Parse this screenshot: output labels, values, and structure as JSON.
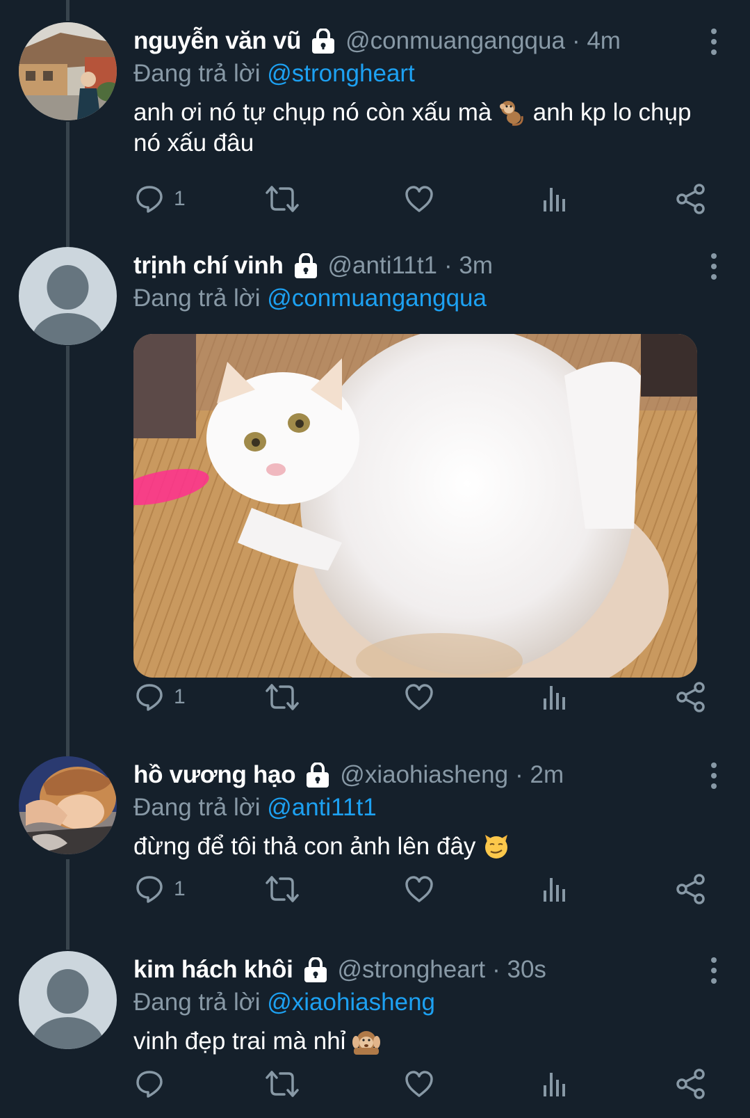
{
  "theme": {
    "background": "#15202b",
    "accent": "#1da1f2",
    "secondary_text": "#8899a6",
    "thread_line": "#38444d"
  },
  "tweets": [
    {
      "name": "nguyễn văn vũ",
      "handle": "@conmuangangqua",
      "time": "· 4m",
      "replying_prefix": "Đang trả lời",
      "replying_to": "@strongheart",
      "text_before_emoji": "anh ơi nó tự chụp nó còn xấu mà",
      "emoji": "monkey",
      "text_after_emoji": "anh kp lo chụp nó xấu đâu",
      "reply_count": "1",
      "avatar": "photo-person-street"
    },
    {
      "name": "trịnh chí vinh",
      "handle": "@anti11t1",
      "time": "· 3m",
      "replying_prefix": "Đang trả lời",
      "replying_to": "@conmuangangqua",
      "media": "white-cat-photo",
      "reply_count": "1",
      "avatar": "default-avatar"
    },
    {
      "name": "hồ vương hạo",
      "handle": "@xiaohiasheng",
      "time": "· 2m",
      "replying_prefix": "Đang trả lời",
      "replying_to": "@anti11t1",
      "text_before_emoji": "đừng để tôi thả con ảnh lên đây",
      "emoji": "smirking-cat",
      "reply_count": "1",
      "avatar": "photo-person-face"
    },
    {
      "name": "kim hách khôi",
      "handle": "@strongheart",
      "time": "· 30s",
      "replying_prefix": "Đang trả lời",
      "replying_to": "@xiaohiasheng",
      "text_before_emoji": "vinh đẹp trai mà nhỉ",
      "emoji": "hear-no-evil-monkey",
      "reply_count": "",
      "avatar": "default-avatar"
    }
  ]
}
